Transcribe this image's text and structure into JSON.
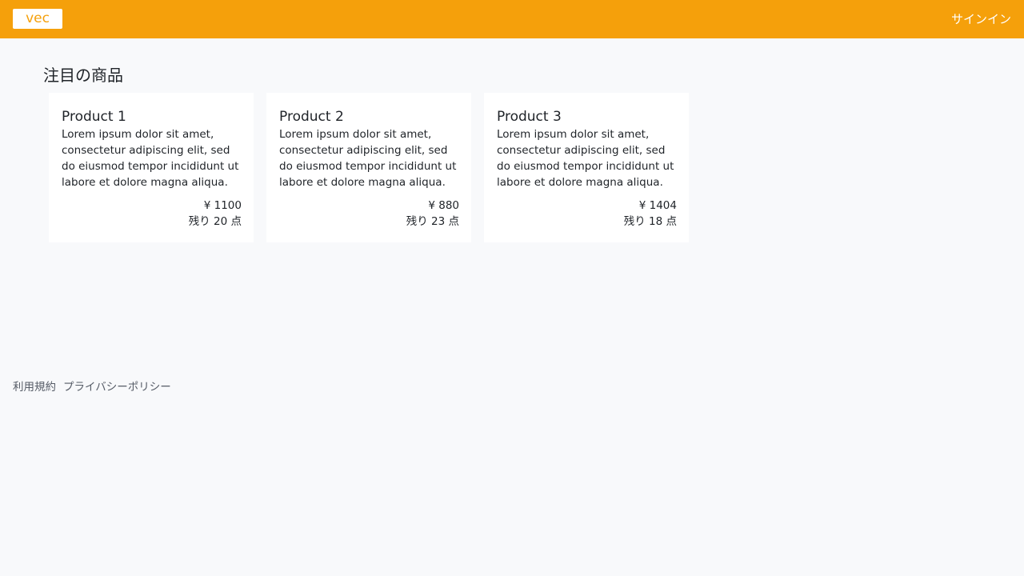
{
  "header": {
    "logo_text": "vec",
    "signin_label": "サインイン",
    "bg_color": "#f5a00b"
  },
  "main": {
    "section_title": "注目の商品",
    "products": [
      {
        "title": "Product 1",
        "description": "Lorem ipsum dolor sit amet, consectetur adipiscing elit, sed do eiusmod tempor incididunt ut labore et dolore magna aliqua.",
        "price": "¥ 1100",
        "stock": "残り 20 点"
      },
      {
        "title": "Product 2",
        "description": "Lorem ipsum dolor sit amet, consectetur adipiscing elit, sed do eiusmod tempor incididunt ut labore et dolore magna aliqua.",
        "price": "¥ 880",
        "stock": "残り 23 点"
      },
      {
        "title": "Product 3",
        "description": "Lorem ipsum dolor sit amet, consectetur adipiscing elit, sed do eiusmod tempor incididunt ut labore et dolore magna aliqua.",
        "price": "¥ 1404",
        "stock": "残り 18 点"
      }
    ]
  },
  "footer": {
    "terms_label": "利用規約",
    "privacy_label": "プライバシーポリシー"
  }
}
